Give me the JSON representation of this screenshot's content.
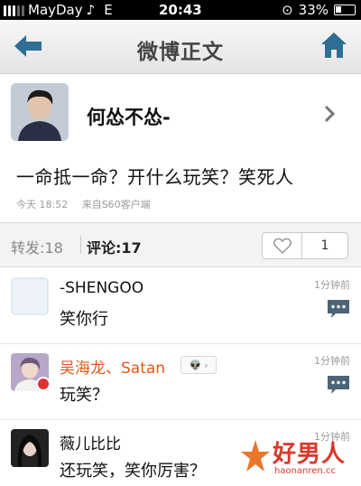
{
  "status_bar": {
    "carrier": "MayDay",
    "network": "E",
    "time": "20:43",
    "battery": "33%"
  },
  "nav": {
    "title": "微博正文",
    "back_icon": "left-arrow-icon",
    "home_icon": "home-icon"
  },
  "author": {
    "name": "何怂不怂-"
  },
  "post": {
    "text": "一命抵一命？开什么玩笑？笑死人",
    "time": "今天 18:52",
    "source": "来自S60客户端"
  },
  "tabs": {
    "repost_label": "转发:18",
    "comment_label": "评论:17",
    "like_count": "1"
  },
  "comments": [
    {
      "name": "-SHENGOO",
      "text": "笑你行",
      "time": "1分钟前"
    },
    {
      "name": "吴海龙、Satan",
      "text": "玩笑？",
      "time": "1分钟前"
    },
    {
      "name": "薇儿比比",
      "text": "还玩笑，笑你厉害？",
      "time": "1分钟前"
    }
  ],
  "watermark": {
    "brand": "好男人",
    "url": "haonanren.cc"
  },
  "colors": {
    "nav_icon": "#2f6f96",
    "vip_name": "#e05a1c",
    "watermark": "#d7392a"
  }
}
